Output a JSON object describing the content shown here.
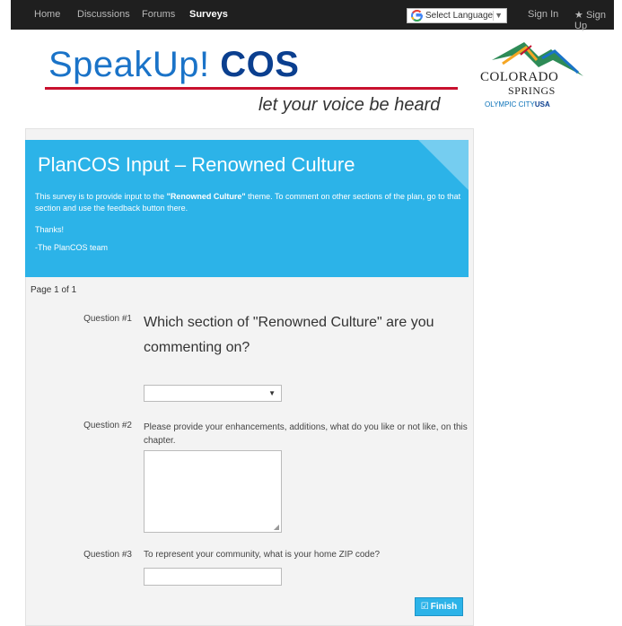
{
  "nav": {
    "items": [
      "Home",
      "Discussions",
      "Forums",
      "Surveys"
    ],
    "language_label": "Select Language",
    "sign_in": "Sign In",
    "sign_up": "Sign Up"
  },
  "header": {
    "brand_part1": "SpeakUp!",
    "brand_part2": "COS",
    "tagline": "let your voice be heard",
    "city_title": "COLORADO",
    "city_sub": "SPRINGS",
    "city_motto_1": "OLYMPIC CITY",
    "city_motto_2": "USA"
  },
  "survey": {
    "title": "PlanCOS Input – Renowned Culture",
    "intro_before": "This survey is to provide input to the ",
    "intro_bold": "\"Renowned Culture\"",
    "intro_after": " theme. To comment on other sections of the plan, go to that section and use the feedback button there.",
    "thanks": "Thanks!",
    "signoff": "-The PlanCOS team",
    "pager": "Page 1 of 1",
    "questions": [
      {
        "label": "Question #1",
        "text": "Which section of \"Renowned Culture\" are you commenting on?",
        "value": ""
      },
      {
        "label": "Question #2",
        "text": "Please provide your enhancements, additions, what do you like or not like, on this chapter.",
        "value": ""
      },
      {
        "label": "Question #3",
        "text": "To represent your community, what is your home ZIP code?",
        "value": ""
      }
    ],
    "finish_label": "Finish"
  },
  "colors": {
    "banner": "#2cb3e8",
    "brand_blue": "#1a73c8",
    "brand_red": "#c8102e",
    "nav_bg": "#1f1f1f"
  }
}
